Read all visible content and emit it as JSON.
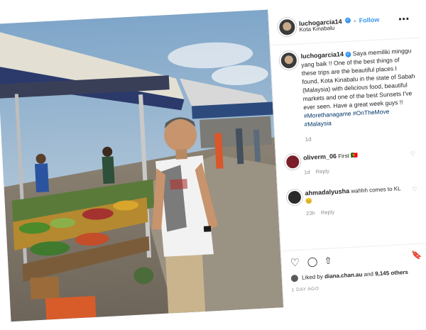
{
  "header": {
    "username": "luchogarcia14",
    "verified_mark": "✓",
    "follow_label": "Follow",
    "separator": "•",
    "location": "Kota Kinabalu",
    "more_icon": "•••"
  },
  "caption": {
    "username": "luchogarcia14",
    "text": "Saya memiliki minggu yang baik !! One of the best things of these trips are the beautiful places I found, Kota Kinabalu in the state of Sabah (Malaysia) with delicious food, beautiful markets and one of the best Sunsets I've ever seen. Have a great week guys !!",
    "hashtags": "#Morethanagame #OnTheMove #Malaysia",
    "age": "1d"
  },
  "comments": [
    {
      "username": "oliverm_06",
      "text": "First 🇵🇹",
      "age": "1d",
      "reply_label": "Reply"
    },
    {
      "username": "ahmadalyusha",
      "text": "wahhh comes to KL 😊",
      "age": "23h",
      "reply_label": "Reply"
    }
  ],
  "actions": {
    "like_icon": "♡",
    "comment_icon": "◯",
    "share_icon": "⇧",
    "save_icon": "🔖"
  },
  "likes": {
    "prefix": "Liked by",
    "user": "diana.chan.au",
    "connector": "and",
    "others": "9,145 others"
  },
  "post_age": "1 DAY AGO",
  "colors": {
    "link_blue": "#3897f0",
    "hashtag_blue": "#003569",
    "muted": "#8e8e8e"
  }
}
